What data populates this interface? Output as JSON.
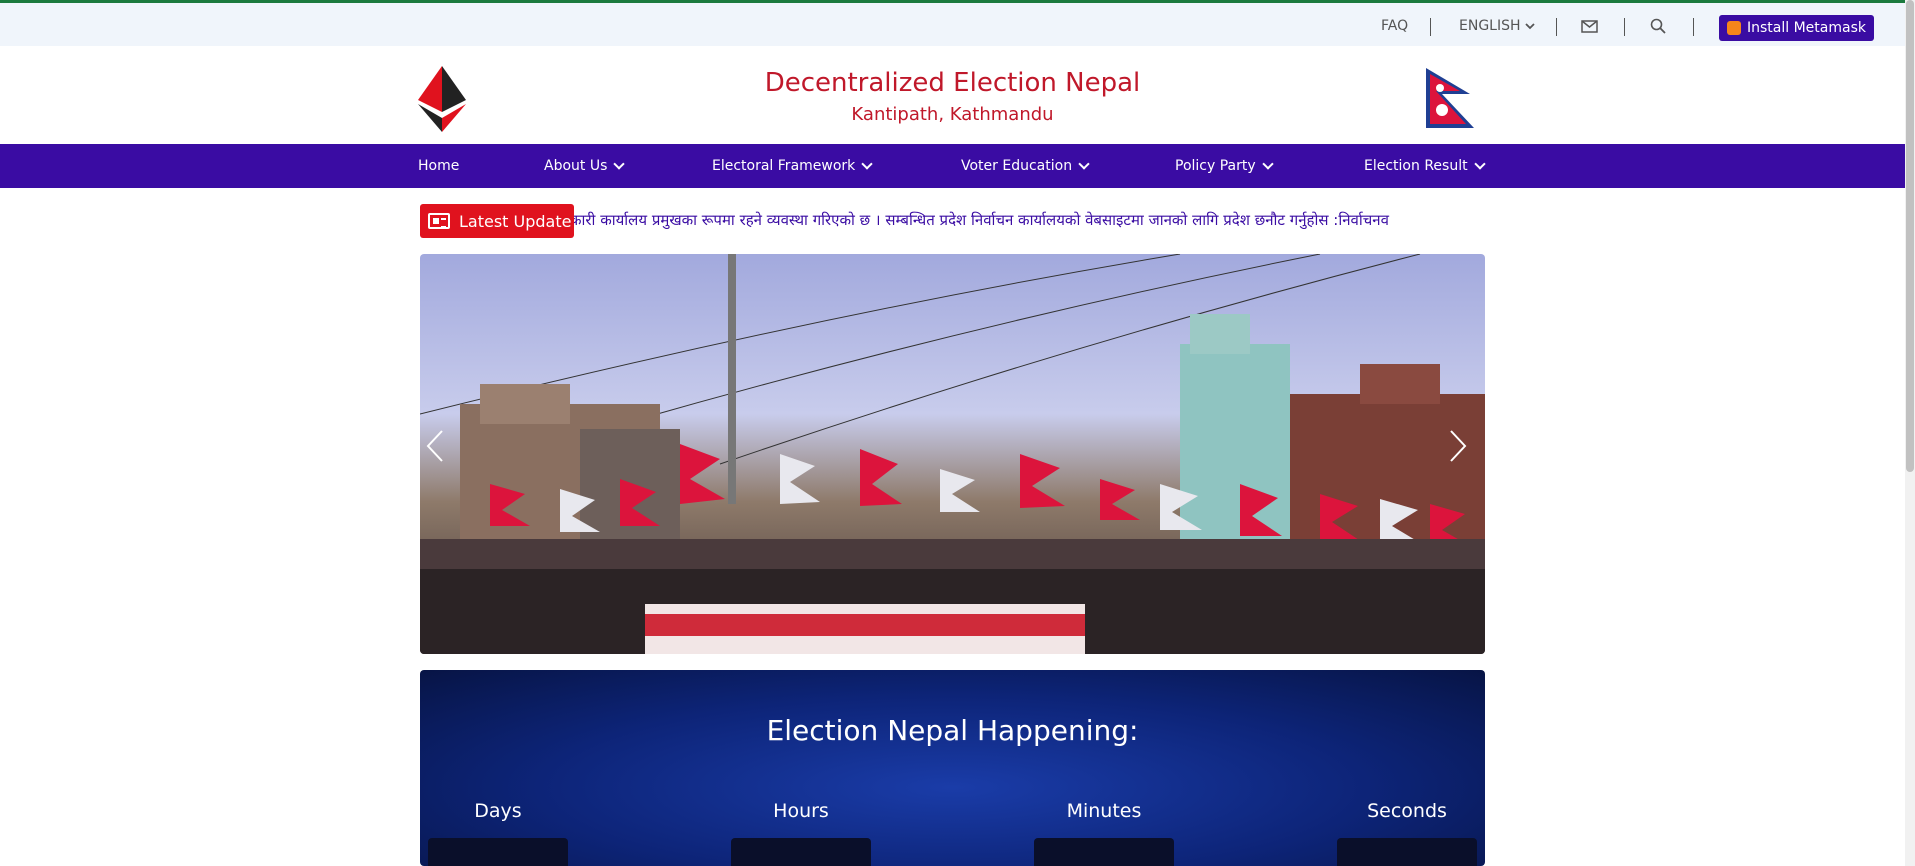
{
  "topbar": {
    "faq": "FAQ",
    "language": "ENGLISH",
    "metamask": "Install Metamask"
  },
  "header": {
    "title": "Decentralized Election Nepal",
    "subtitle": "Kantipath, Kathmandu"
  },
  "nav": {
    "items": [
      {
        "label": "Home"
      },
      {
        "label": "About Us"
      },
      {
        "label": "Electoral Framework"
      },
      {
        "label": "Voter Education"
      },
      {
        "label": "Policy Party"
      },
      {
        "label": "Election Result"
      }
    ]
  },
  "ticker": {
    "label": "Latest Update",
    "text": "कारी कार्यालय प्रमुखका रूपमा रहने व्यवस्था गरिएको छ । सम्बन्धित प्रदेश निर्वाचन कार्यालयको वेबसाइटमा जानको लागि प्रदेश छनौट गर्नुहोस :निर्वाचनव"
  },
  "countdown": {
    "title": "Election Nepal Happening:",
    "labels": {
      "days": "Days",
      "hours": "Hours",
      "minutes": "Minutes",
      "seconds": "Seconds"
    }
  },
  "colors": {
    "nav": "#3a0ca3",
    "brand_red": "#c0182a",
    "ticker_badge": "#e0121e",
    "top_border": "#1b7a3e"
  },
  "icons": [
    "chevron-down-icon",
    "mail-icon",
    "search-icon",
    "fox-icon",
    "news-icon",
    "ethereum-logo",
    "nepal-flag"
  ]
}
